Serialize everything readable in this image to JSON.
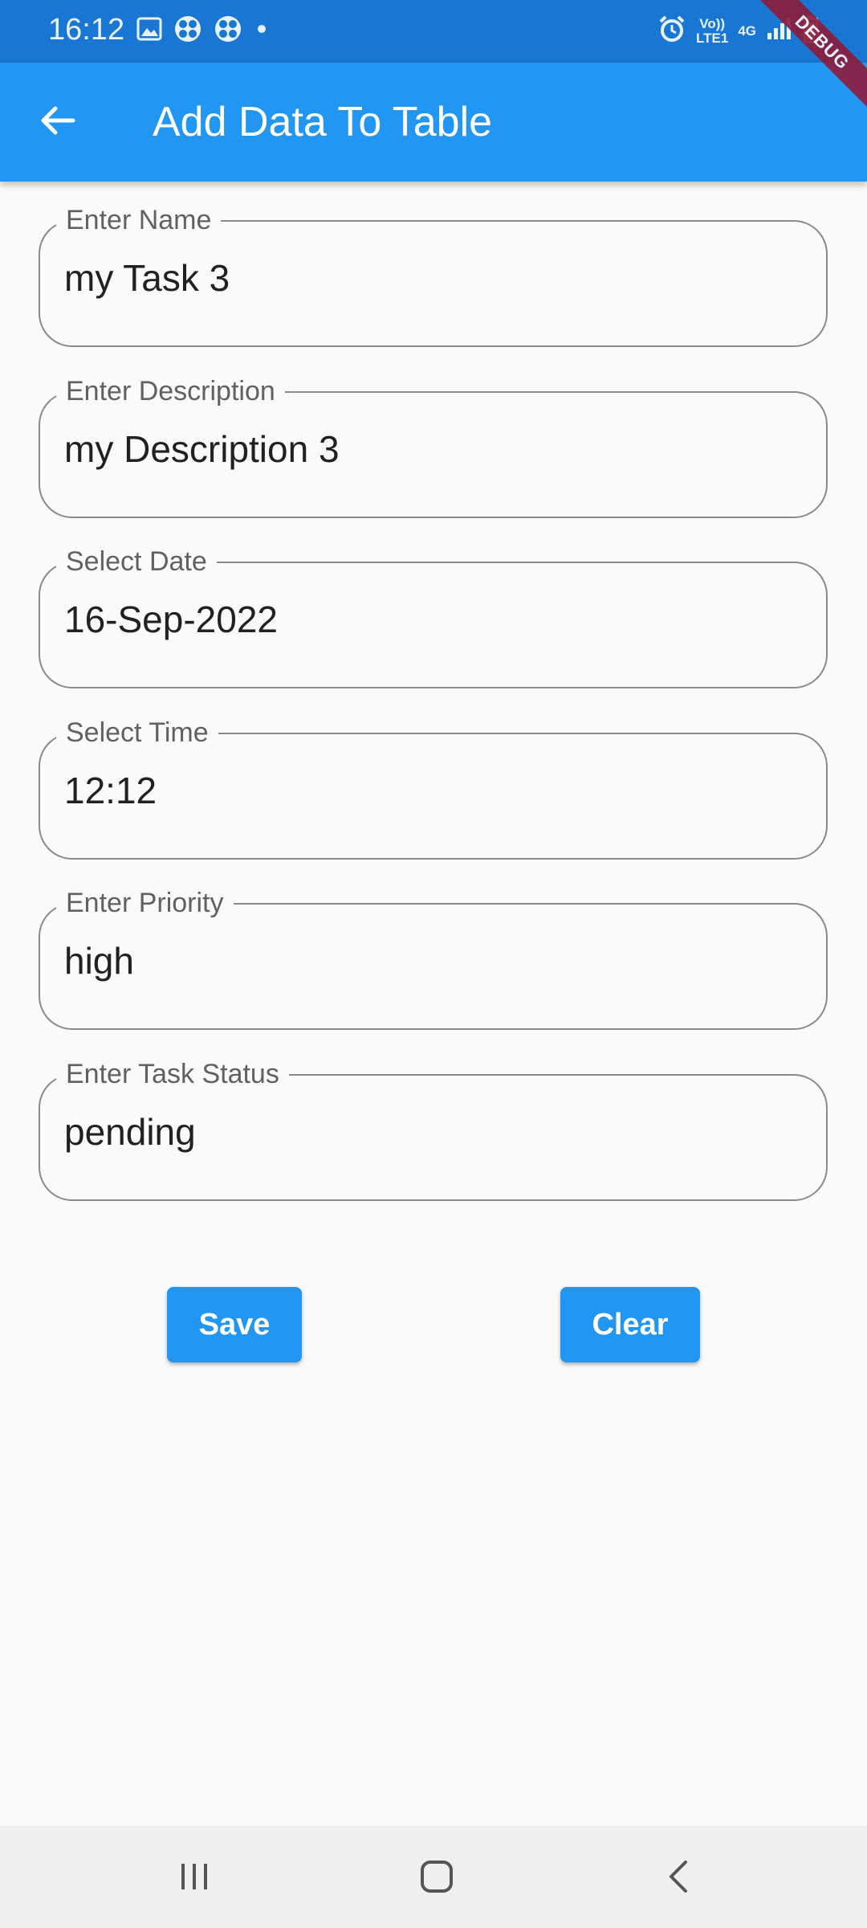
{
  "status_bar": {
    "time": "16:12",
    "network_top": "Vo))",
    "network_bottom": "LTE1",
    "network_gen": "4G",
    "icons": [
      "image-icon",
      "pinwheel-icon",
      "pinwheel-icon",
      "dot-icon",
      "alarm-icon",
      "signal-icon",
      "battery-icon"
    ]
  },
  "debug_banner": "DEBUG",
  "app_bar": {
    "title": "Add Data To Table",
    "back_icon": "arrow-back-icon"
  },
  "form": {
    "name": {
      "label": "Enter Name",
      "value": "my Task 3"
    },
    "description": {
      "label": "Enter Description",
      "value": "my Description 3"
    },
    "date": {
      "label": "Select Date",
      "value": "16-Sep-2022"
    },
    "time": {
      "label": "Select Time",
      "value": "12:12"
    },
    "priority": {
      "label": "Enter Priority",
      "value": "high"
    },
    "status": {
      "label": "Enter Task Status",
      "value": "pending"
    }
  },
  "actions": {
    "save_label": "Save",
    "clear_label": "Clear"
  },
  "nav_bar": {
    "icons": [
      "recents-icon",
      "home-icon",
      "back-icon"
    ]
  },
  "colors": {
    "primary": "#2196f3",
    "status_bar": "#1976d2",
    "debug": "#8e1b3a",
    "background": "#fafafa"
  }
}
